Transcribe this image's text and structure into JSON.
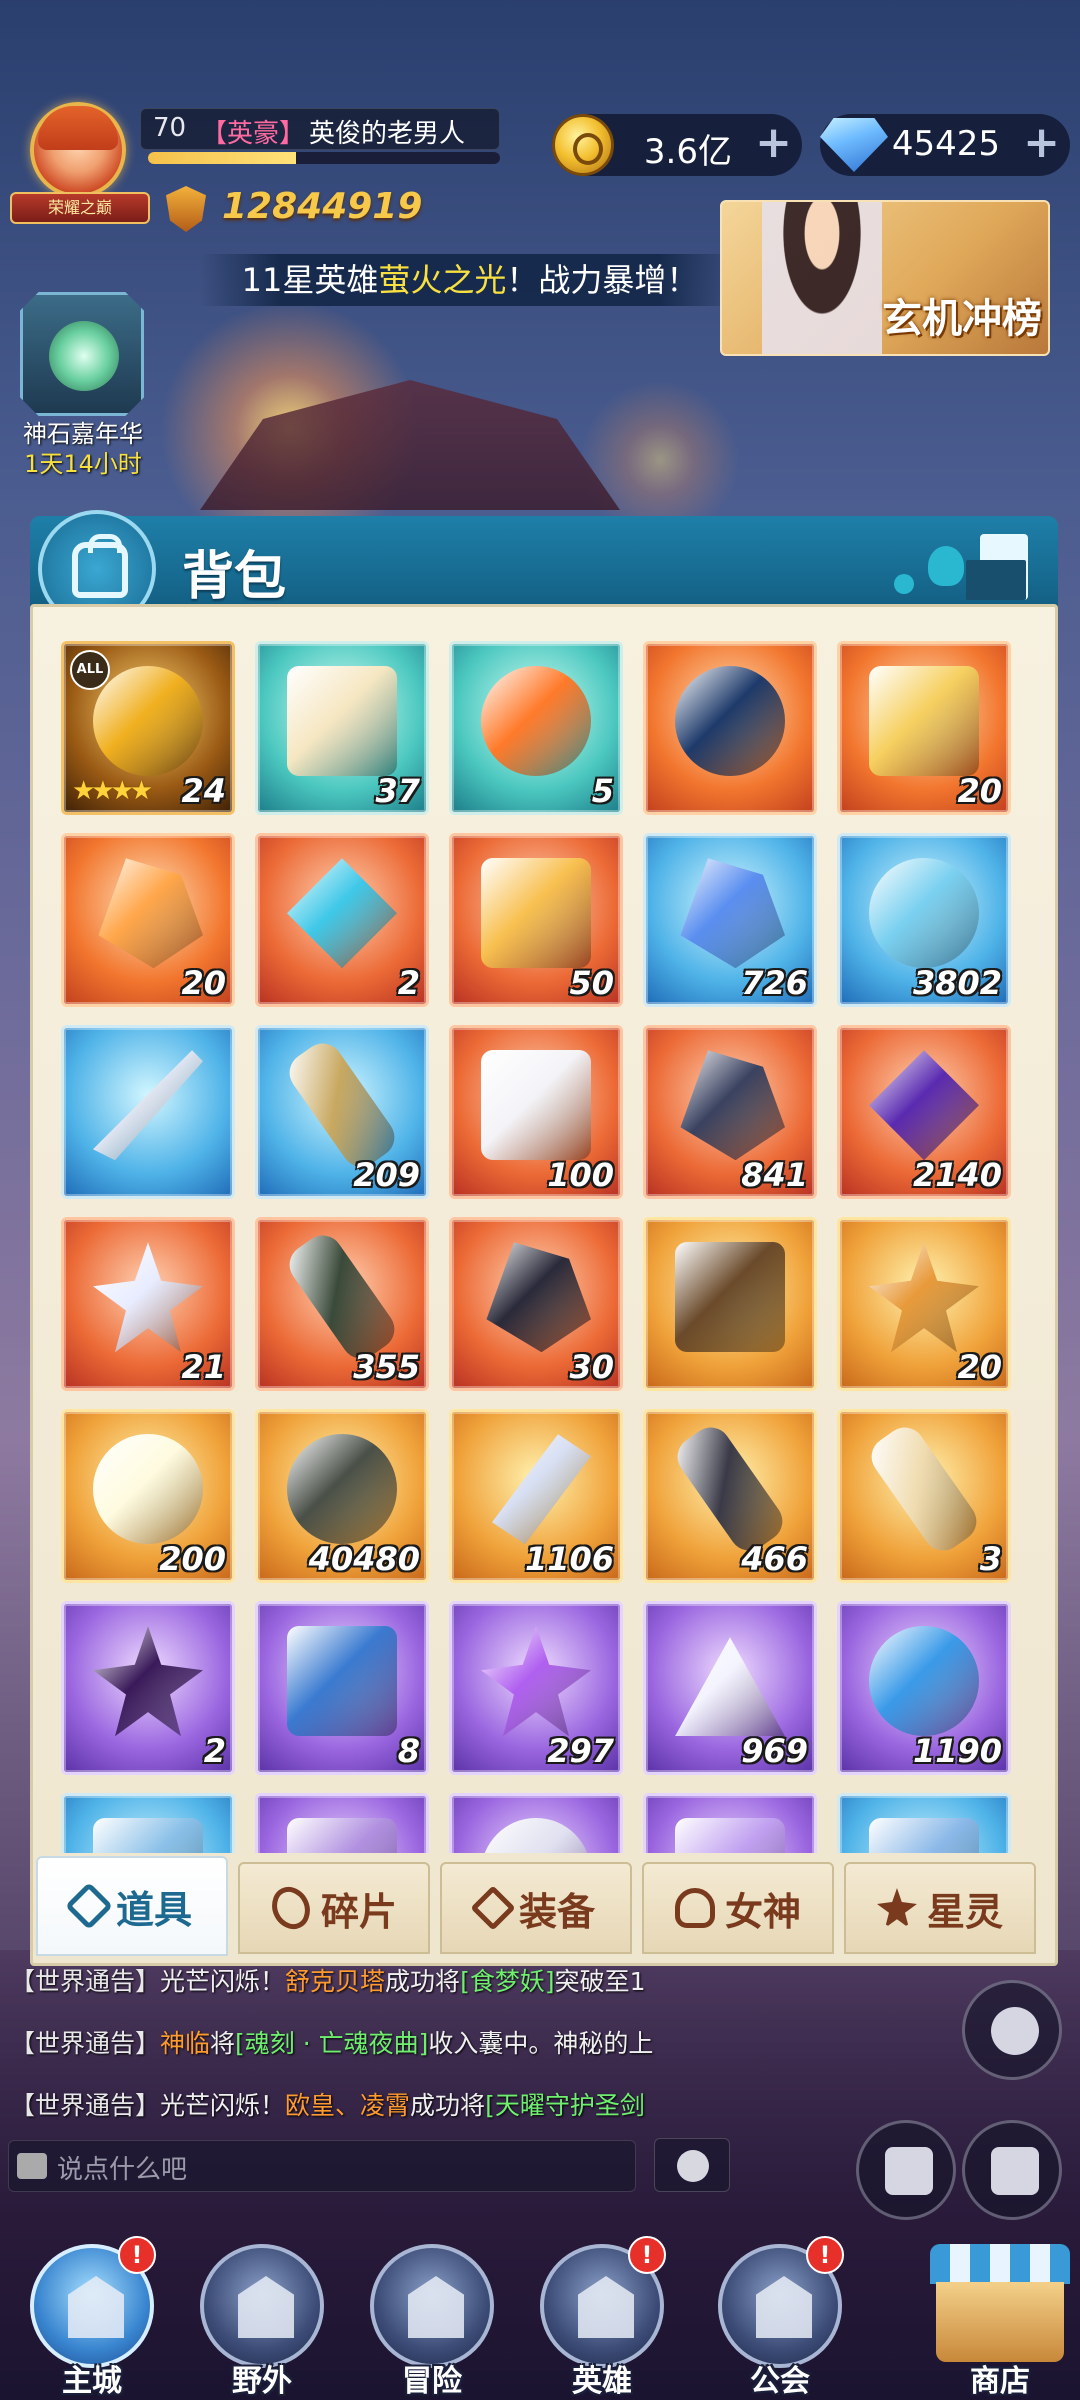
{
  "hud": {
    "player_level": "70",
    "player_title": "【英豪】",
    "player_name": "英俊的老男人",
    "avatar_banner": "荣耀之巅",
    "exp_fraction": 0.42,
    "power": "12844919",
    "gold": "3.6亿",
    "gems": "45425",
    "plus": "+"
  },
  "news": {
    "prefix": "11星英雄",
    "highlight": "萤火之光",
    "suffix": "！战力暴增！"
  },
  "event_card": {
    "label": "玄机冲榜"
  },
  "left_event": {
    "name": "神石嘉年华",
    "time": "1天14小时"
  },
  "bag": {
    "title": "背包",
    "items": [
      {
        "qty": "24",
        "tier": "darkgold",
        "shape": "art-circle",
        "color": "#f0b020",
        "all_badge": "ALL",
        "stars": "★★★★"
      },
      {
        "qty": "37",
        "tier": "teal",
        "shape": "art-box",
        "color": "#f6e7c2"
      },
      {
        "qty": "5",
        "tier": "teal",
        "shape": "art-circle",
        "color": "#ff7a2a"
      },
      {
        "qty": "",
        "tier": "orange",
        "shape": "art-circle",
        "color": "#1e3a6a"
      },
      {
        "qty": "20",
        "tier": "orange",
        "shape": "art-box",
        "color": "#f6d060"
      },
      {
        "qty": "20",
        "tier": "orange",
        "shape": "art-shard",
        "color": "#ffa64a"
      },
      {
        "qty": "2",
        "tier": "redorange",
        "shape": "art-diamond",
        "color": "#3ec8e8"
      },
      {
        "qty": "50",
        "tier": "redorange",
        "shape": "art-box",
        "color": "#f8c050"
      },
      {
        "qty": "726",
        "tier": "blue",
        "shape": "art-shard",
        "color": "#5a8ef0"
      },
      {
        "qty": "3802",
        "tier": "blue",
        "shape": "art-circle",
        "color": "#7ad0f0"
      },
      {
        "qty": "",
        "tier": "blue",
        "shape": "art-feather",
        "color": "#e0e6f2"
      },
      {
        "qty": "209",
        "tier": "blue",
        "shape": "art-scroll",
        "color": "#c8a860"
      },
      {
        "qty": "100",
        "tier": "redorange",
        "shape": "art-box",
        "color": "#f4f4f8"
      },
      {
        "qty": "841",
        "tier": "redorange",
        "shape": "art-shard",
        "color": "#3a4260"
      },
      {
        "qty": "2140",
        "tier": "redorange",
        "shape": "art-diamond",
        "color": "#5a2ab0"
      },
      {
        "qty": "21",
        "tier": "redorange",
        "shape": "art-star",
        "color": "#e8ecff"
      },
      {
        "qty": "355",
        "tier": "redorange",
        "shape": "art-scroll",
        "color": "#3a4a3a"
      },
      {
        "qty": "30",
        "tier": "redorange",
        "shape": "art-shard",
        "color": "#2a2a3a"
      },
      {
        "qty": "",
        "tier": "gold",
        "shape": "art-box",
        "color": "#6a4a2a"
      },
      {
        "qty": "20",
        "tier": "gold",
        "shape": "art-star",
        "color": "#e89a3a"
      },
      {
        "qty": "200",
        "tier": "gold",
        "shape": "art-circle",
        "color": "#fffbe0"
      },
      {
        "qty": "40480",
        "tier": "gold",
        "shape": "art-circle",
        "color": "#4a5048"
      },
      {
        "qty": "1106",
        "tier": "gold",
        "shape": "art-cone",
        "color": "#d8e0f4"
      },
      {
        "qty": "466",
        "tier": "gold",
        "shape": "art-scroll",
        "color": "#3a3a48"
      },
      {
        "qty": "3",
        "tier": "gold",
        "shape": "art-scroll",
        "color": "#f0dcb0"
      },
      {
        "qty": "2",
        "tier": "purple",
        "shape": "art-star",
        "color": "#3a1a5a"
      },
      {
        "qty": "8",
        "tier": "purple",
        "shape": "art-box",
        "color": "#3a7ad0"
      },
      {
        "qty": "297",
        "tier": "purple",
        "shape": "art-star",
        "color": "#b060f0"
      },
      {
        "qty": "969",
        "tier": "purple",
        "shape": "art-mound",
        "color": "#f4f4ff"
      },
      {
        "qty": "1190",
        "tier": "purple",
        "shape": "art-circle",
        "color": "#3a9ae8"
      },
      {
        "qty": "",
        "tier": "blue",
        "shape": "art-box",
        "color": "#8ac0e8"
      },
      {
        "qty": "",
        "tier": "purple",
        "shape": "art-box",
        "color": "#b090e0"
      },
      {
        "qty": "",
        "tier": "purple",
        "shape": "art-circle",
        "color": "#e0e0f0"
      },
      {
        "qty": "",
        "tier": "purple",
        "shape": "art-box",
        "color": "#c0a0f0"
      },
      {
        "qty": "",
        "tier": "blue",
        "shape": "art-box",
        "color": "#8ab8e8"
      }
    ]
  },
  "tabs": [
    {
      "label": "道具",
      "icon": "items",
      "active": true
    },
    {
      "label": "碎片",
      "icon": "shard",
      "active": false
    },
    {
      "label": "装备",
      "icon": "equip",
      "active": false
    },
    {
      "label": "女神",
      "icon": "goddess",
      "active": false
    },
    {
      "label": "星灵",
      "icon": "star",
      "active": false
    }
  ],
  "chat": [
    {
      "tag": "【世界通告】",
      "parts": [
        {
          "t": "光芒闪烁！",
          "c": ""
        },
        {
          "t": "舒克贝塔",
          "c": "c-orange"
        },
        {
          "t": "成功将",
          "c": ""
        },
        {
          "t": "[食梦妖]",
          "c": "c-green"
        },
        {
          "t": "突破至1",
          "c": ""
        }
      ]
    },
    {
      "tag": "【世界通告】",
      "parts": [
        {
          "t": "神临",
          "c": "c-orange"
        },
        {
          "t": "将",
          "c": ""
        },
        {
          "t": "[魂刻 · 亡魂夜曲]",
          "c": "c-green"
        },
        {
          "t": "收入囊中。神秘的上",
          "c": ""
        }
      ]
    },
    {
      "tag": "【世界通告】",
      "parts": [
        {
          "t": "光芒闪烁！",
          "c": ""
        },
        {
          "t": "欧皇、凌霄",
          "c": "c-orange"
        },
        {
          "t": "成功将",
          "c": ""
        },
        {
          "t": "[天曜守护圣剑",
          "c": "c-green"
        }
      ]
    }
  ],
  "chat_input": {
    "placeholder": "说点什么吧"
  },
  "nav": [
    {
      "label": "主城",
      "badge": "!",
      "active": true
    },
    {
      "label": "野外",
      "badge": "",
      "active": false
    },
    {
      "label": "冒险",
      "badge": "",
      "active": false
    },
    {
      "label": "英雄",
      "badge": "!",
      "active": false
    },
    {
      "label": "公会",
      "badge": "!",
      "active": false
    },
    {
      "label": "商店",
      "badge": "",
      "active": false
    }
  ]
}
